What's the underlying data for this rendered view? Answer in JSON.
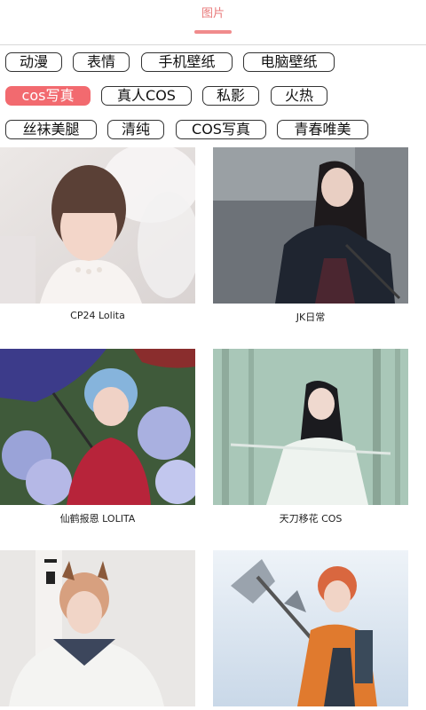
{
  "header": {
    "tab_label": "图片"
  },
  "tags": [
    [
      "动漫",
      "表情",
      "手机壁纸",
      "电脑壁纸"
    ],
    [
      "cos写真",
      "真人COS",
      "私影",
      "火热"
    ],
    [
      "丝袜美腿",
      "清纯",
      "COS写真",
      "青春唯美"
    ]
  ],
  "active_tag": "cos写真",
  "accent_color": "#f26a6f",
  "gallery": [
    {
      "caption": "CP24 Lolita"
    },
    {
      "caption": "JK日常"
    },
    {
      "caption": "仙鹤报恩 LOLITA"
    },
    {
      "caption": "天刀移花 COS"
    },
    {
      "caption": ""
    },
    {
      "caption": ""
    }
  ]
}
